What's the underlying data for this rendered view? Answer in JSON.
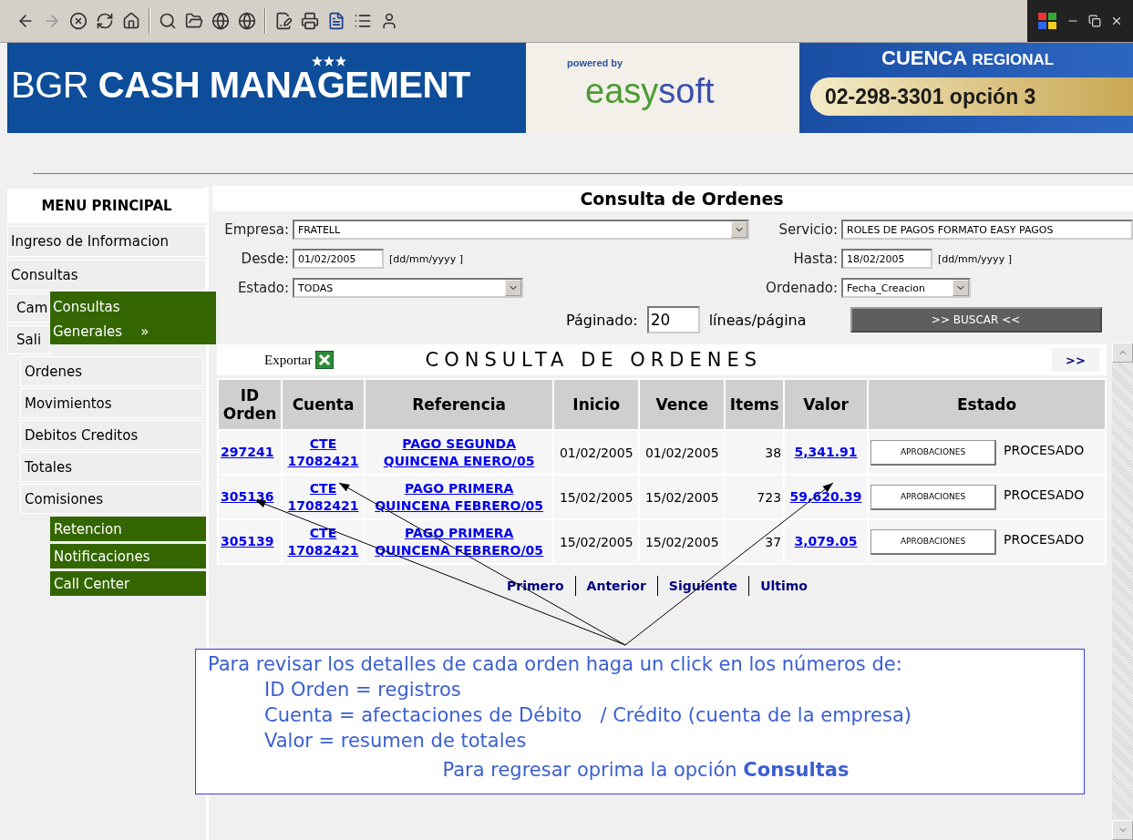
{
  "banner": {
    "title_light": "BGR",
    "title_bold": "CASH MANAGEMENT",
    "powered_by": "powered by",
    "brand_parts": [
      "easy",
      "soft"
    ],
    "region_bold": "CUENCA",
    "region": "REGIONAL",
    "phone": "02-298-3301 opción 3"
  },
  "sidebar": {
    "title": "MENU PRINCIPAL",
    "items": [
      {
        "label": "Ingreso de Informacion"
      },
      {
        "label": "Consultas"
      },
      {
        "label": "Cam"
      },
      {
        "label": "Sali"
      }
    ],
    "flyout": {
      "label": "Consultas Generales",
      "arrow": "»"
    },
    "submenu": [
      {
        "label": "Ordenes",
        "kind": "plain"
      },
      {
        "label": "Movimientos",
        "kind": "plain"
      },
      {
        "label": "Debitos Creditos",
        "kind": "plain"
      },
      {
        "label": "Totales",
        "kind": "plain"
      },
      {
        "label": "Comisiones",
        "kind": "plain"
      },
      {
        "label": "Retencion",
        "kind": "flyout"
      },
      {
        "label": "Notificaciones",
        "kind": "flyout"
      },
      {
        "label": "Call Center",
        "kind": "flyout"
      }
    ]
  },
  "form": {
    "title": "Consulta de Ordenes",
    "left": [
      {
        "label": "Empresa:",
        "kind": "select",
        "value": "FRATELL"
      },
      {
        "label": "Desde:",
        "kind": "text",
        "value": "01/02/2005",
        "hint": "[dd/mm/yyyy ]"
      },
      {
        "label": "Estado:",
        "kind": "select",
        "value": "TODAS"
      }
    ],
    "right": [
      {
        "label": "Servicio:",
        "kind": "text",
        "value": "ROLES DE PAGOS FORMATO EASY PAGOS"
      },
      {
        "label": "Hasta:",
        "kind": "text",
        "value": "18/02/2005",
        "hint": "[dd/mm/yyyy ]"
      },
      {
        "label": "Ordenado:",
        "kind": "select",
        "value": "Fecha_Creacion"
      }
    ],
    "paging_label": "Páginado:",
    "paging_value": "20",
    "paging_unit": "líneas/página",
    "search_button": ">> BUSCAR <<"
  },
  "results": {
    "export": "Exportar",
    "title": "CONSULTA DE ORDENES",
    "next": ">>",
    "columns": [
      "ID\nOrden",
      "Cuenta",
      "Referencia",
      "Inicio",
      "Vence",
      "Items",
      "Valor",
      "Estado"
    ],
    "rows": [
      {
        "id": "297241",
        "cuenta": "CTE\n17082421",
        "referencia": "PAGO SEGUNDA\nQUINCENA ENERO/05",
        "inicio": "01/02/2005",
        "vence": "01/02/2005",
        "items": "38",
        "valor": "5,341.91",
        "action": "APROBACIONES",
        "estado": "PROCESADO"
      },
      {
        "id": "305136",
        "cuenta": "CTE\n17082421",
        "referencia": "PAGO PRIMERA\nQUINCENA FEBRERO/05",
        "inicio": "15/02/2005",
        "vence": "15/02/2005",
        "items": "723",
        "valor": "59,620.39",
        "action": "APROBACIONES",
        "estado": "PROCESADO"
      },
      {
        "id": "305139",
        "cuenta": "CTE\n17082421",
        "referencia": "PAGO PRIMERA\nQUINCENA FEBRERO/05",
        "inicio": "15/02/2005",
        "vence": "15/02/2005",
        "items": "37",
        "valor": "3,079.05",
        "action": "APROBACIONES",
        "estado": "PROCESADO"
      }
    ],
    "pagination": [
      "Primero",
      "Anterior",
      "Siguiente",
      "Ultimo"
    ]
  },
  "callout": {
    "intro": "Para revisar los detalles de cada orden haga un click en los números de:",
    "lines": [
      "ID Orden = registros",
      "Cuenta = afectaciones de Débito   / Crédito (cuenta de la empresa)",
      "Valor = resumen de totales"
    ],
    "footer": "Para regresar oprima la opción **Consultas**"
  }
}
